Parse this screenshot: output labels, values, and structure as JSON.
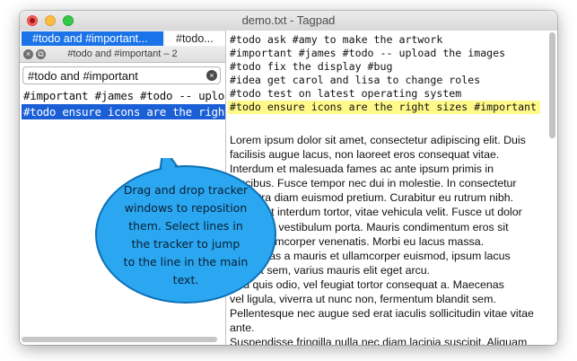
{
  "window": {
    "title": "demo.txt - Tagpad"
  },
  "tracker": {
    "tabs": [
      {
        "label": "#todo and #important...",
        "active": true
      },
      {
        "label": "#todo...",
        "active": false
      }
    ],
    "title": "#todo and #important – 2",
    "search": {
      "value": "#todo and #important"
    },
    "results": [
      {
        "text": "#important #james #todo -- upload the images",
        "selected": false
      },
      {
        "text": "#todo ensure icons are the right sizes #important",
        "selected": true
      }
    ]
  },
  "editor": {
    "lines": [
      "#todo ask #amy to make the artwork",
      "#important #james #todo -- upload the images",
      "#todo fix the display #bug",
      "#idea get carol and lisa to change roles",
      "#todo test on latest operating system",
      "#todo ensure icons are the right sizes #important"
    ],
    "highlighted_line_index": 5,
    "paragraph": "Lorem ipsum dolor sit amet, consectetur adipiscing elit. Duis\nfacilisis augue lacus, non laoreet eros consequat vitae.\nInterdum et malesuada fames ac ante ipsum primis in\nfaucibus. Fusce tempor nec dui in molestie. In consectetur\npharetra diam euismod pretium. Curabitur eu rutrum nibh.\nPraesent interdum tortor, vitae vehicula velit. Fusce ut dolor\nconvallis, vestibulum porta. Mauris condimentum eros sit\namet ullamcorper venenatis. Morbi eu lacus massa.\nMaecenas a mauris et ullamcorper euismod, ipsum lacus\nlaoreet sem, varius mauris elit eget arcu.\nSed quis odio, vel feugiat tortor consequat a. Maecenas\nvel ligula, viverra ut nunc non, fermentum blandit sem.\nPellentesque nec augue sed erat iaculis sollicitudin vitae vitae ante.\nSuspendisse fringilla nulla nec diam lacinia suscipit. Aliquam\nerat volutpat. Suspendisse posuere ut enim at posuere.\nAliquam rhoncus, ligula vitae convallis accumsan, dolor metus"
  },
  "callout": {
    "lines": [
      "Drag and drop tracker",
      "windows to reposition",
      "them.  Select lines in",
      "the tracker to jump",
      "to the line in the main",
      "text."
    ]
  },
  "colors": {
    "selection": "#1a5fd6",
    "tab_active": "#1a73e8",
    "highlight": "#fff98a",
    "bubble_fill": "#2aa7f0",
    "bubble_stroke": "#0d6fb3"
  },
  "icons": {
    "close": "close-icon",
    "minimize": "minimize-icon",
    "zoom": "zoom-icon",
    "clear": "clear-search-icon"
  }
}
